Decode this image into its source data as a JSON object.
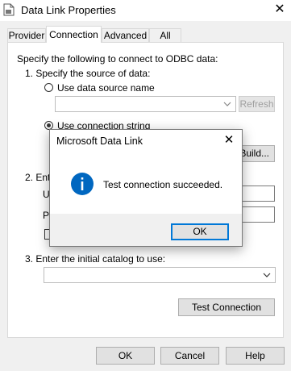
{
  "window": {
    "title": "Data Link Properties"
  },
  "tabs": [
    {
      "label": "Provider"
    },
    {
      "label": "Connection"
    },
    {
      "label": "Advanced"
    },
    {
      "label": "All"
    }
  ],
  "connection": {
    "intro": "Specify the following to connect to ODBC data:",
    "step1": "1. Specify the source of data:",
    "dsn_label": "Use data source name",
    "dsn_value": "",
    "refresh": "Refresh",
    "connstr_label": "Use connection string",
    "build": "Build...",
    "step2_partial": "2. Ente",
    "user_partial": "Us",
    "pass_partial": "Pa",
    "step3": "3. Enter the initial catalog to use:",
    "catalog_value": "",
    "test": "Test Connection"
  },
  "dialog": {
    "title": "Microsoft Data Link",
    "message": "Test connection succeeded.",
    "ok": "OK"
  },
  "footer": {
    "ok": "OK",
    "cancel": "Cancel",
    "help": "Help"
  },
  "colors": {
    "info_icon": "#0067c0",
    "focus_border": "#0078d7"
  }
}
